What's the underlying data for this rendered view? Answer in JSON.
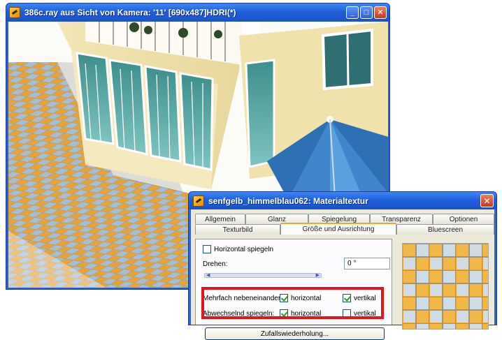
{
  "render_window": {
    "title": "386c.ray aus Sicht von Kamera: '11' [690x487]HDRI(*)",
    "buttons": {
      "minimize": "_",
      "maximize": "□",
      "close": "✕"
    },
    "icons": [
      "app-icon",
      "minimize-icon",
      "maximize-icon",
      "close-icon"
    ],
    "colors": {
      "titlebar": "#1f5fdb",
      "tile_orange": "#e8a53c",
      "tile_blue": "#9fb7c9",
      "umbrella": "#3f86cc"
    }
  },
  "dialog": {
    "title": "senfgelb_himmelblau062: Materialtextur",
    "close": "✕",
    "tabs_back": [
      "Allgemein",
      "Glanz",
      "Spiegelung",
      "Transparenz",
      "Optionen"
    ],
    "tabs_front": [
      "Texturbild",
      "Größe und Ausrichtung",
      "Bluescreen"
    ],
    "active_tab": "Größe und Ausrichtung",
    "horizontal_spiegeln": {
      "label": "Horizontal spiegeln",
      "checked": false
    },
    "drehen": {
      "label": "Drehen:",
      "value": "0 °"
    },
    "mehrfach": {
      "label": "Mehrfach nebeneinander:",
      "horizontal": "horizontal",
      "horizontal_checked": true,
      "vertikal": "vertikal",
      "vertikal_checked": true
    },
    "abwechselnd": {
      "label": "Abwechselnd spiegeln:",
      "horizontal": "horizontal",
      "horizontal_checked": true,
      "vertikal": "vertikal",
      "vertikal_checked": false
    },
    "zufall_button": "Zufallswiederholung...",
    "highlight_color": "#e4161d"
  }
}
